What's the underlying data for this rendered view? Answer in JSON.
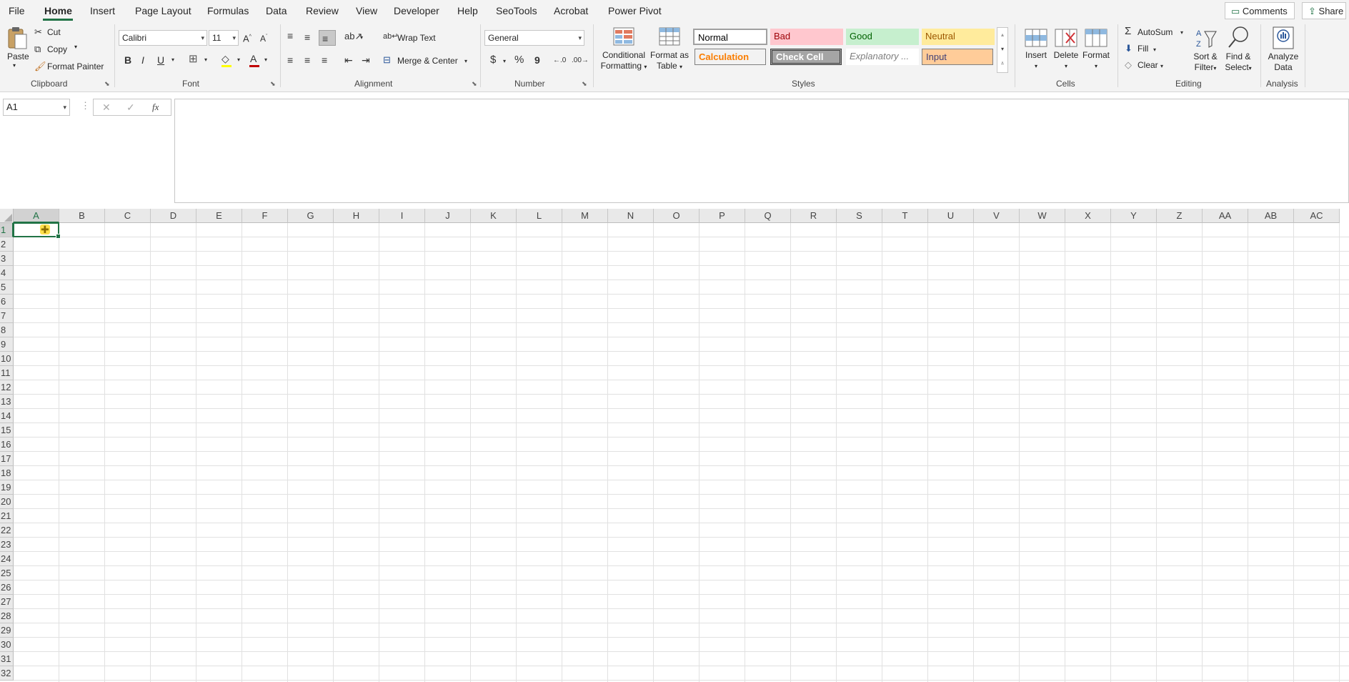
{
  "tabs": [
    "File",
    "Home",
    "Insert",
    "Page Layout",
    "Formulas",
    "Data",
    "Review",
    "View",
    "Developer",
    "Help",
    "SeoTools",
    "Acrobat",
    "Power Pivot"
  ],
  "top_buttons": {
    "comments": "Comments",
    "share": "Share"
  },
  "clipboard": {
    "paste": "Paste",
    "cut": "Cut",
    "copy": "Copy",
    "format_painter": "Format Painter",
    "label": "Clipboard"
  },
  "font": {
    "name": "Calibri",
    "size": "11",
    "bold": "B",
    "italic": "I",
    "underline": "U",
    "label": "Font"
  },
  "alignment": {
    "wrap_text": "Wrap Text",
    "merge_center": "Merge & Center",
    "label": "Alignment"
  },
  "number": {
    "format": "General",
    "currency": "$",
    "percent": "%",
    "comma": "9",
    "label": "Number"
  },
  "styles": {
    "conditional_formatting": [
      "Conditional",
      "Formatting"
    ],
    "format_as_table": [
      "Format as",
      "Table"
    ],
    "cells": [
      "Normal",
      "Bad",
      "Good",
      "Neutral",
      "Calculation",
      "Check Cell",
      "Explanatory ...",
      "Input"
    ],
    "label": "Styles"
  },
  "cells_group": {
    "insert": "Insert",
    "delete": "Delete",
    "format": "Format",
    "label": "Cells"
  },
  "editing": {
    "autosum": "AutoSum",
    "fill": "Fill",
    "clear": "Clear",
    "sort_filter": [
      "Sort &",
      "Filter"
    ],
    "find_select": [
      "Find &",
      "Select"
    ],
    "label": "Editing"
  },
  "analysis": {
    "analyze_data": [
      "Analyze",
      "Data"
    ],
    "label": "Analysis"
  },
  "formula_bar": {
    "name_box": "A1",
    "cancel": "✕",
    "enter": "✓",
    "fx": "fx",
    "value": ""
  },
  "columns": [
    "A",
    "B",
    "C",
    "D",
    "E",
    "F",
    "G",
    "H",
    "I",
    "J",
    "K",
    "L",
    "M",
    "N",
    "O",
    "P",
    "Q",
    "R",
    "S",
    "T",
    "U",
    "V",
    "W",
    "X",
    "Y",
    "Z",
    "AA",
    "AB",
    "AC"
  ],
  "rows": [
    "1",
    "2",
    "3",
    "4",
    "5",
    "6",
    "7",
    "8",
    "9",
    "10",
    "11",
    "12",
    "13",
    "14",
    "15",
    "16",
    "17",
    "18",
    "19",
    "20",
    "21",
    "22",
    "23",
    "24",
    "25",
    "26",
    "27",
    "28",
    "29",
    "30",
    "31",
    "32"
  ],
  "selected_cell": "A1",
  "colors": {
    "accent": "#217346",
    "bad_bg": "#ffc7ce",
    "good_bg": "#c6efce",
    "neutral_bg": "#ffeb9c",
    "input_bg": "#ffcc99",
    "check_bg": "#a5a5a5"
  }
}
